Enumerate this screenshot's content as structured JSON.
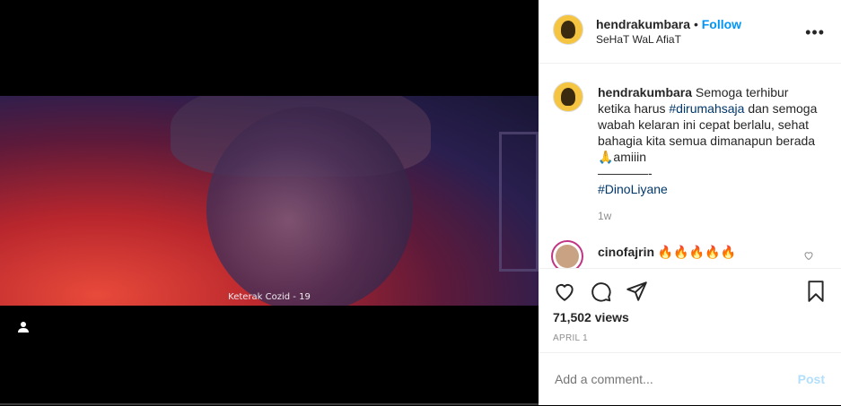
{
  "video": {
    "caption": "Keterak Cozid - 19"
  },
  "header": {
    "username": "hendrakumbara",
    "separator": "•",
    "follow_label": "Follow",
    "subtitle": "SeHaT WaL AfiaT",
    "more_icon": "more-dots-icon"
  },
  "post": {
    "username": "hendrakumbara",
    "text_1": " Semoga terhibur ketika harus ",
    "hashtag_1": "#dirumahsaja",
    "text_2": " dan semoga wabah kelaran ini cepat berlalu, sehat bahagia kita semua dimanapun berada 🙏amiiin",
    "divider": "————-",
    "hashtag_2": "#DinoLiyane",
    "time": "1w"
  },
  "comment": {
    "username": "cinofajrin",
    "text": " 🔥🔥🔥🔥🔥"
  },
  "actions": {
    "icons": [
      "heart-icon",
      "comment-icon",
      "share-icon",
      "bookmark-icon"
    ],
    "views": "71,502 views",
    "date": "APRIL 1"
  },
  "add_comment": {
    "placeholder": "Add a comment...",
    "post_label": "Post"
  },
  "colors": {
    "accent": "#0095f6",
    "post_disabled": "#b2dffc",
    "hashtag": "#00376b"
  }
}
